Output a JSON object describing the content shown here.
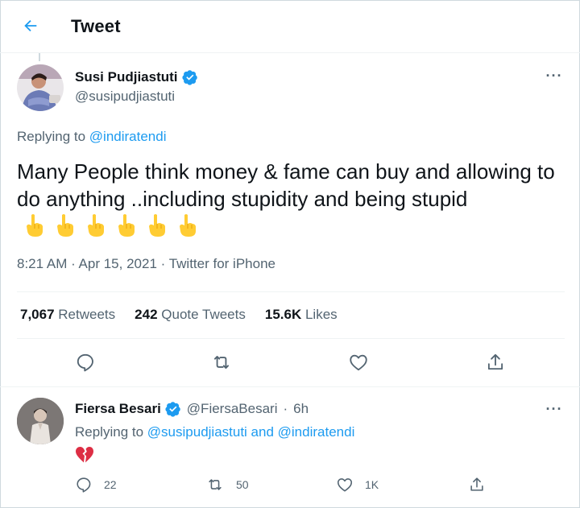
{
  "header": {
    "title": "Tweet"
  },
  "tweet": {
    "author_name": "Susi Pudjiastuti",
    "author_handle": "@susipudjiastuti",
    "replying_prefix": "Replying to",
    "replying_to": "@indiratendi",
    "text": "Many People think money & fame can buy and allowing to do anything ..including stupidity and being stupid",
    "emoji": [
      "pointing-up-hand",
      "pointing-up-hand",
      "pointing-up-hand",
      "pointing-up-hand",
      "pointing-up-hand",
      "pointing-up-hand"
    ],
    "meta": "8:21 AM · Apr 15, 2021 · Twitter for iPhone",
    "stats": {
      "retweets_count": "7,067",
      "retweets_label": "Retweets",
      "quotes_count": "242",
      "quotes_label": "Quote Tweets",
      "likes_count": "15.6K",
      "likes_label": "Likes"
    }
  },
  "reply": {
    "author_name": "Fiersa Besari",
    "author_handle": "@FiersaBesari",
    "dot": "·",
    "time": "6h",
    "replying_prefix": "Replying to",
    "replying_to": "@susipudjiastuti and @indiratendi",
    "body_emoji": "broken-heart",
    "counts": {
      "replies": "22",
      "retweets": "50",
      "likes": "1K"
    }
  },
  "colors": {
    "accent": "#1d9bf0",
    "secondary_text": "#536471",
    "emoji_yellow": "#ffcc33",
    "broken_heart": "#dd2e44"
  }
}
